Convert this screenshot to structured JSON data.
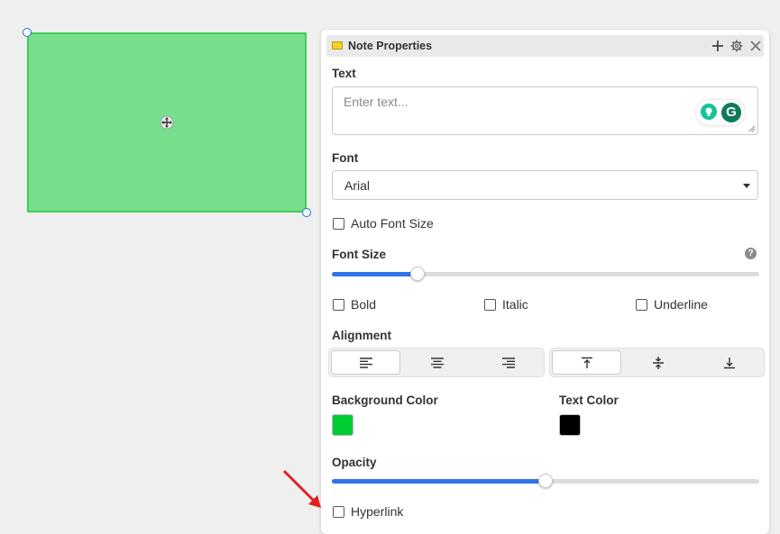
{
  "panel": {
    "title": "Note Properties",
    "text_label": "Text",
    "text_placeholder": "Enter text...",
    "text_value": "",
    "font_label": "Font",
    "font_value": "Arial",
    "auto_font_size_label": "Auto Font Size",
    "auto_font_size_checked": false,
    "font_size_label": "Font Size",
    "font_size_level": 0.2,
    "bold_label": "Bold",
    "italic_label": "Italic",
    "underline_label": "Underline",
    "alignment_label": "Alignment",
    "horizontal_alignment": [
      "left",
      "center",
      "right"
    ],
    "horizontal_selected": "left",
    "vertical_alignment": [
      "top",
      "middle",
      "bottom"
    ],
    "vertical_selected": "top",
    "background_color_label": "Background Color",
    "background_color": "#00cc33",
    "text_color_label": "Text Color",
    "text_color": "#000000",
    "opacity_label": "Opacity",
    "opacity_level": 0.5,
    "hyperlink_label": "Hyperlink"
  },
  "canvas": {
    "note_fill": "#77de8c",
    "note_border": "#3fcf58"
  },
  "icons": {
    "header_note": "note-icon",
    "header_add": "plus-icon",
    "header_settings": "gear-icon",
    "header_close": "close-icon",
    "move": "move-icon",
    "help": "help-icon",
    "grammarly": "grammarly-icon"
  },
  "accent_color": "#2f74ea"
}
